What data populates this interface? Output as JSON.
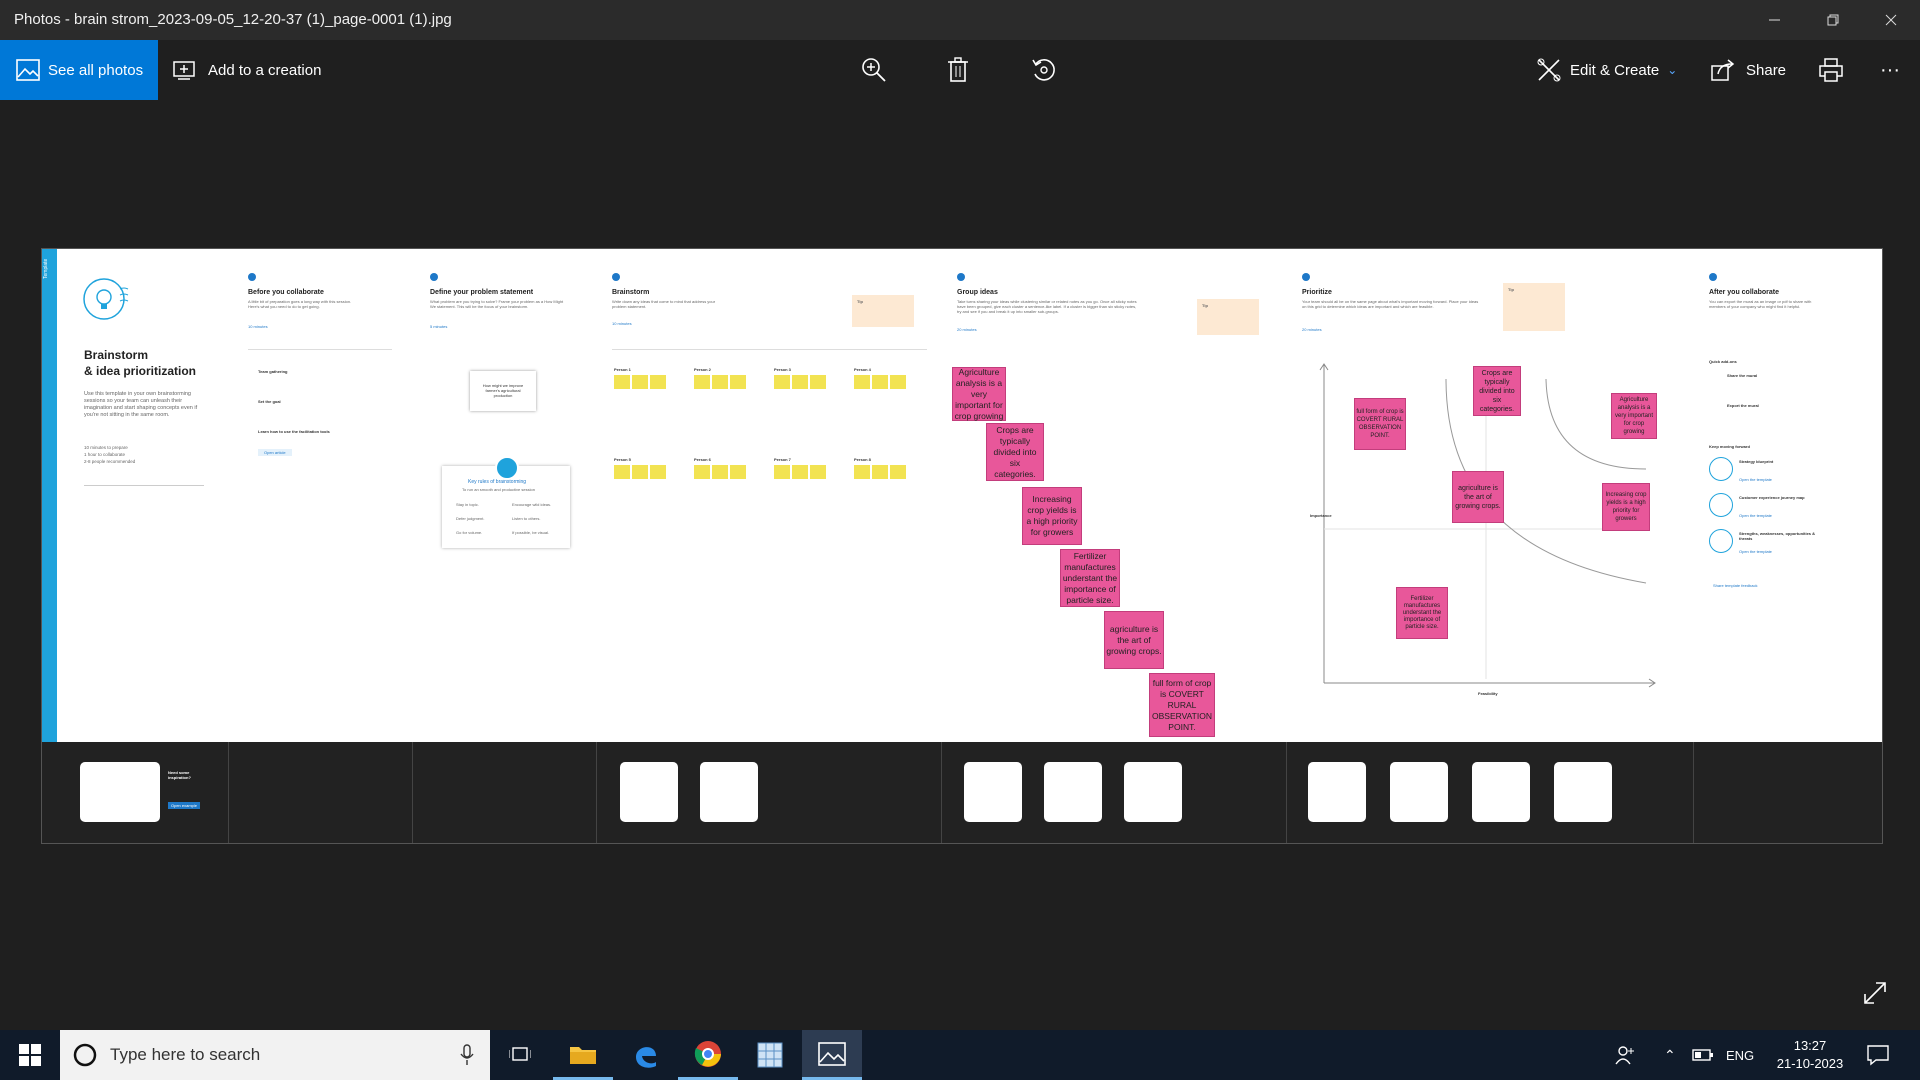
{
  "window": {
    "title": "Photos - brain strom_2023-09-05_12-20-37 (1)_page-0001 (1).jpg",
    "minimize_icon": "minimize-icon",
    "maximize_icon": "restore-icon",
    "close_icon": "close-icon"
  },
  "toolbar": {
    "see_all_photos": "See all photos",
    "add_to_creation": "Add to a creation",
    "edit_create": "Edit & Create",
    "share": "Share",
    "accent": "#0078d7"
  },
  "board": {
    "intro": {
      "tag": "Template",
      "title_line1": "Brainstorm",
      "title_line2": "& idea prioritization",
      "desc": "Use this template in your own brainstorming sessions so your team can unleash their imagination and start shaping concepts even if you're not sitting in the same room.",
      "stat1": "10 minutes to prepare",
      "stat2": "1 hour to collaborate",
      "stat3": "2-8 people recommended"
    },
    "before": {
      "title": "Before you collaborate",
      "desc": "A little bit of preparation goes a long way with this session. Here's what you need to do to get going.",
      "time": "10 minutes",
      "step_a": "Team gathering",
      "step_b": "Set the goal",
      "step_c": "Learn how to use the facilitation tools",
      "link": "Open article"
    },
    "define": {
      "title": "Define your problem statement",
      "desc": "What problem are you trying to solve? Frame your problem as a How Might We statement. This will be the focus of your brainstorm.",
      "time": "5 minutes",
      "card": "How might we improve farmer's agricultural production",
      "rules_title": "Key rules of brainstorming",
      "rules_sub": "To run an smooth and productive session",
      "rule1": "Stay in topic.",
      "rule2": "Encourage wild ideas.",
      "rule3": "Defer judgment.",
      "rule4": "Listen to others.",
      "rule5": "Go for volume.",
      "rule6": "If possible, be visual."
    },
    "brainstorm": {
      "title": "Brainstorm",
      "desc": "Write down any ideas that come to mind that address your problem statement.",
      "time": "10 minutes",
      "tip": "Tip",
      "persons": [
        "Person 1",
        "Person 2",
        "Person 3",
        "Person 4",
        "Person 5",
        "Person 6",
        "Person 7",
        "Person 8"
      ]
    },
    "group": {
      "title": "Group ideas",
      "desc": "Take turns sharing your ideas while clustering similar or related notes as you go. Once all sticky notes have been grouped, give each cluster a sentence-like label. If a cluster is bigger than six sticky notes, try and see if you and break it up into smaller sub-groups.",
      "time": "20 minutes",
      "tip": "Tip",
      "stickies": [
        "Agriculture analysis is a very important for crop growing",
        "Crops are typically divided into six categories.",
        "Increasing crop yields is a high priority for growers",
        "Fertilizer manufactures understant the importance of particle size.",
        "agriculture is the art of growing crops.",
        "full form of crop is COVERT RURAL OBSERVATION POINT."
      ]
    },
    "prioritize": {
      "title": "Prioritize",
      "desc": "Your team should all be on the same page about what's important moving forward. Place your ideas on this grid to determine which ideas are important and which are feasible.",
      "time": "20 minutes",
      "tip": "Tip",
      "y_label": "Importance",
      "x_label": "Feasibility",
      "stickies": [
        "Crops are typically divided into six categories.",
        "full form of crop is COVERT RURAL OBSERVATION POINT.",
        "Agriculture analysis is a very important for crop growing",
        "agriculture is the art of growing crops.",
        "Increasing crop yields is a high priority for growers",
        "Fertilizer manufactures understant the importance of particle size."
      ]
    },
    "after": {
      "title": "After you collaborate",
      "desc": "You can export the mural as an image or pdf to share with members of your company who might find it helpful.",
      "quick_add": "Quick add-ons",
      "qa1": "Share the mural",
      "qa2": "Export the mural",
      "keep": "Keep moving forward",
      "k1": "Strategy blueprint",
      "k2": "Customer experience journey map",
      "k3": "Strengths, weaknesses, opportunities & threats",
      "link": "Open the template",
      "feedback": "Share template feedback"
    },
    "strip": {
      "need": "Need some inspiration?",
      "example": "Open example"
    }
  },
  "taskbar": {
    "search_placeholder": "Type here to search",
    "lang": "ENG",
    "time": "13:27",
    "date": "21-10-2023"
  }
}
